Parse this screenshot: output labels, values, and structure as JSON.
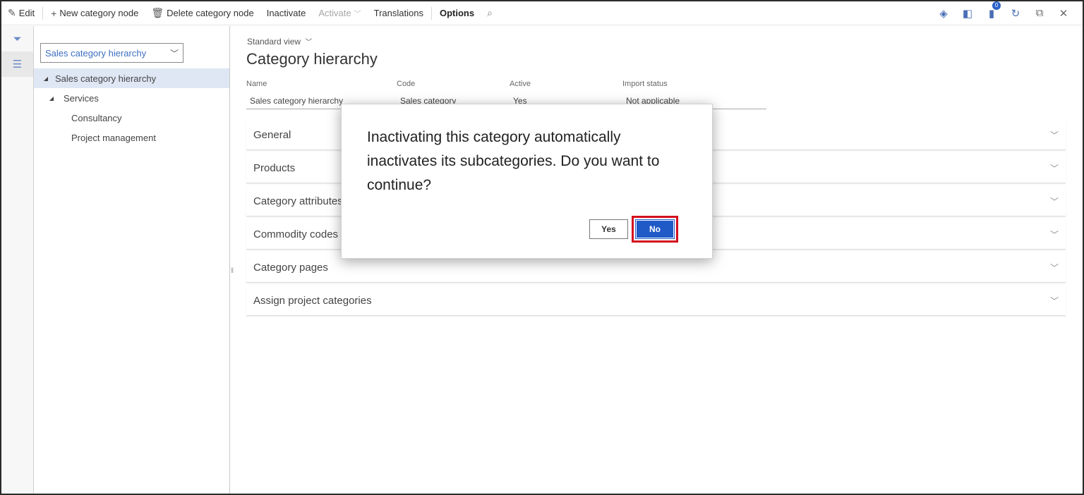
{
  "toolbar": {
    "edit": "Edit",
    "new_category_node": "New category node",
    "delete_category_node": "Delete category node",
    "inactivate": "Inactivate",
    "activate": "Activate",
    "translations": "Translations",
    "options": "Options",
    "notification_count": "0"
  },
  "tree": {
    "hierarchy_select": "Sales category hierarchy",
    "nodes": [
      {
        "label": "Sales category hierarchy"
      },
      {
        "label": "Services"
      },
      {
        "label": "Consultancy"
      },
      {
        "label": "Project management"
      }
    ]
  },
  "main": {
    "view": "Standard view",
    "title": "Category hierarchy",
    "fields": [
      {
        "label": "Name",
        "value": "Sales category hierarchy"
      },
      {
        "label": "Code",
        "value": "Sales category"
      },
      {
        "label": "Active",
        "value": "Yes"
      },
      {
        "label": "Import status",
        "value": "Not applicable"
      }
    ],
    "fasttabs": [
      "General",
      "Products",
      "Category attributes",
      "Commodity codes",
      "Category pages",
      "Assign project categories"
    ]
  },
  "dialog": {
    "message": "Inactivating this category automatically inactivates its subcategories. Do you want to continue?",
    "yes_label": "Yes",
    "no_label": "No"
  },
  "colors": {
    "accent": "#1f5ac6",
    "highlight": "#d40f1d",
    "selected_row": "#dfe7f5"
  }
}
